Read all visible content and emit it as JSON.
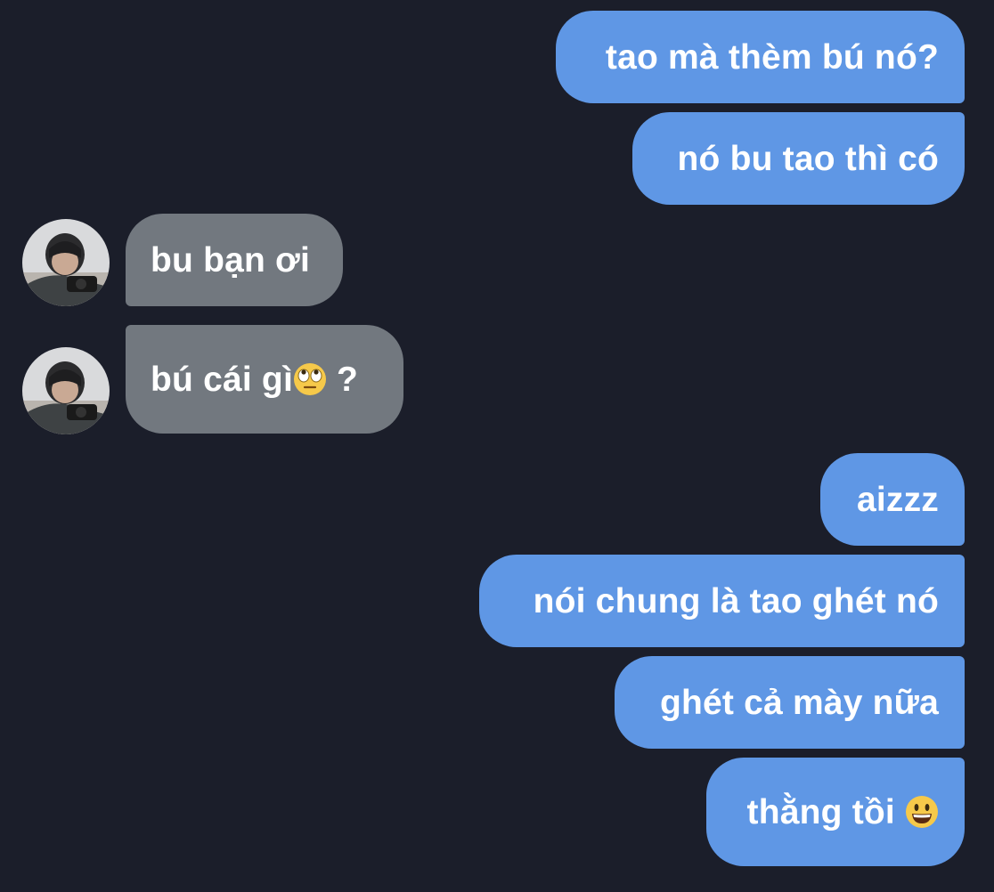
{
  "messages": [
    {
      "id": "m1",
      "sender": "me",
      "text": "tao mà thèm bú nó?"
    },
    {
      "id": "m2",
      "sender": "me",
      "text": "nó bu tao thì có"
    },
    {
      "id": "m3",
      "sender": "other",
      "text": "bu bạn ơi"
    },
    {
      "id": "m4",
      "sender": "other",
      "text_before": "bú cái gì",
      "emoji": "eye-roll-emoji",
      "text_after": " ?"
    },
    {
      "id": "m5",
      "sender": "me",
      "text": "aizzz"
    },
    {
      "id": "m6",
      "sender": "me",
      "text": "nói chung là tao ghét nó"
    },
    {
      "id": "m7",
      "sender": "me",
      "text": "ghét cả mày nữa"
    },
    {
      "id": "m8",
      "sender": "me",
      "text_before": "thằng tồi ",
      "emoji": "grinning-face-emoji"
    }
  ],
  "colors": {
    "background": "#1b1e2a",
    "outgoing_bubble": "#5f97e5",
    "incoming_bubble": "#72787f",
    "text": "#ffffff"
  }
}
